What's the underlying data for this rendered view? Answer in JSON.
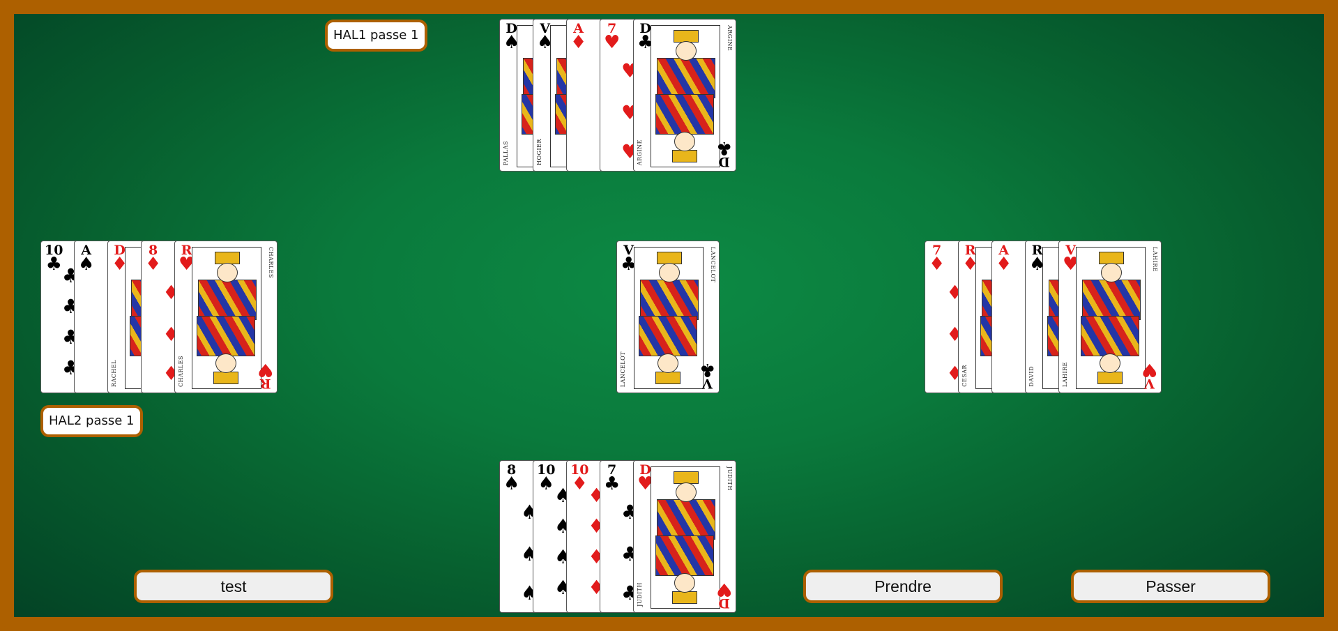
{
  "colors": {
    "felt": "#0a7a3c",
    "frame": "#ad6000",
    "red_suit": "#e21b1b",
    "black_suit": "#000000"
  },
  "labels": {
    "hal1": "HAL1 passe 1",
    "hal2": "HAL2 passe 1"
  },
  "buttons": {
    "test": "test",
    "prendre": "Prendre",
    "passer": "Passer"
  },
  "hands": {
    "north": [
      {
        "rank": "D",
        "suit": "♠",
        "color": "black",
        "name": "PALLAS",
        "face": true
      },
      {
        "rank": "V",
        "suit": "♠",
        "color": "black",
        "name": "HOGIER",
        "face": true
      },
      {
        "rank": "A",
        "suit": "♦",
        "color": "red",
        "face": false
      },
      {
        "rank": "7",
        "suit": "♥",
        "color": "red",
        "face": false
      },
      {
        "rank": "D",
        "suit": "♣",
        "color": "black",
        "name": "ARGINE",
        "face": true
      }
    ],
    "west": [
      {
        "rank": "10",
        "suit": "♣",
        "color": "black",
        "face": false
      },
      {
        "rank": "A",
        "suit": "♠",
        "color": "black",
        "face": false
      },
      {
        "rank": "D",
        "suit": "♦",
        "color": "red",
        "name": "RACHEL",
        "face": true
      },
      {
        "rank": "8",
        "suit": "♦",
        "color": "red",
        "face": false
      },
      {
        "rank": "R",
        "suit": "♥",
        "color": "red",
        "name": "CHARLES",
        "face": true
      }
    ],
    "center": [
      {
        "rank": "V",
        "suit": "♣",
        "color": "black",
        "name": "LANCELOT",
        "face": true
      }
    ],
    "east": [
      {
        "rank": "7",
        "suit": "♦",
        "color": "red",
        "face": false
      },
      {
        "rank": "R",
        "suit": "♦",
        "color": "red",
        "name": "CESAR",
        "face": true
      },
      {
        "rank": "A",
        "suit": "♦",
        "color": "red",
        "face": false
      },
      {
        "rank": "R",
        "suit": "♠",
        "color": "black",
        "name": "DAVID",
        "face": true
      },
      {
        "rank": "V",
        "suit": "♥",
        "color": "red",
        "name": "LAHIRE",
        "face": true
      }
    ],
    "south": [
      {
        "rank": "8",
        "suit": "♠",
        "color": "black",
        "face": false
      },
      {
        "rank": "10",
        "suit": "♠",
        "color": "black",
        "face": false
      },
      {
        "rank": "10",
        "suit": "♦",
        "color": "red",
        "face": false
      },
      {
        "rank": "7",
        "suit": "♣",
        "color": "black",
        "face": false
      },
      {
        "rank": "D",
        "suit": "♥",
        "color": "red",
        "name": "JUDITH",
        "face": true
      }
    ]
  }
}
